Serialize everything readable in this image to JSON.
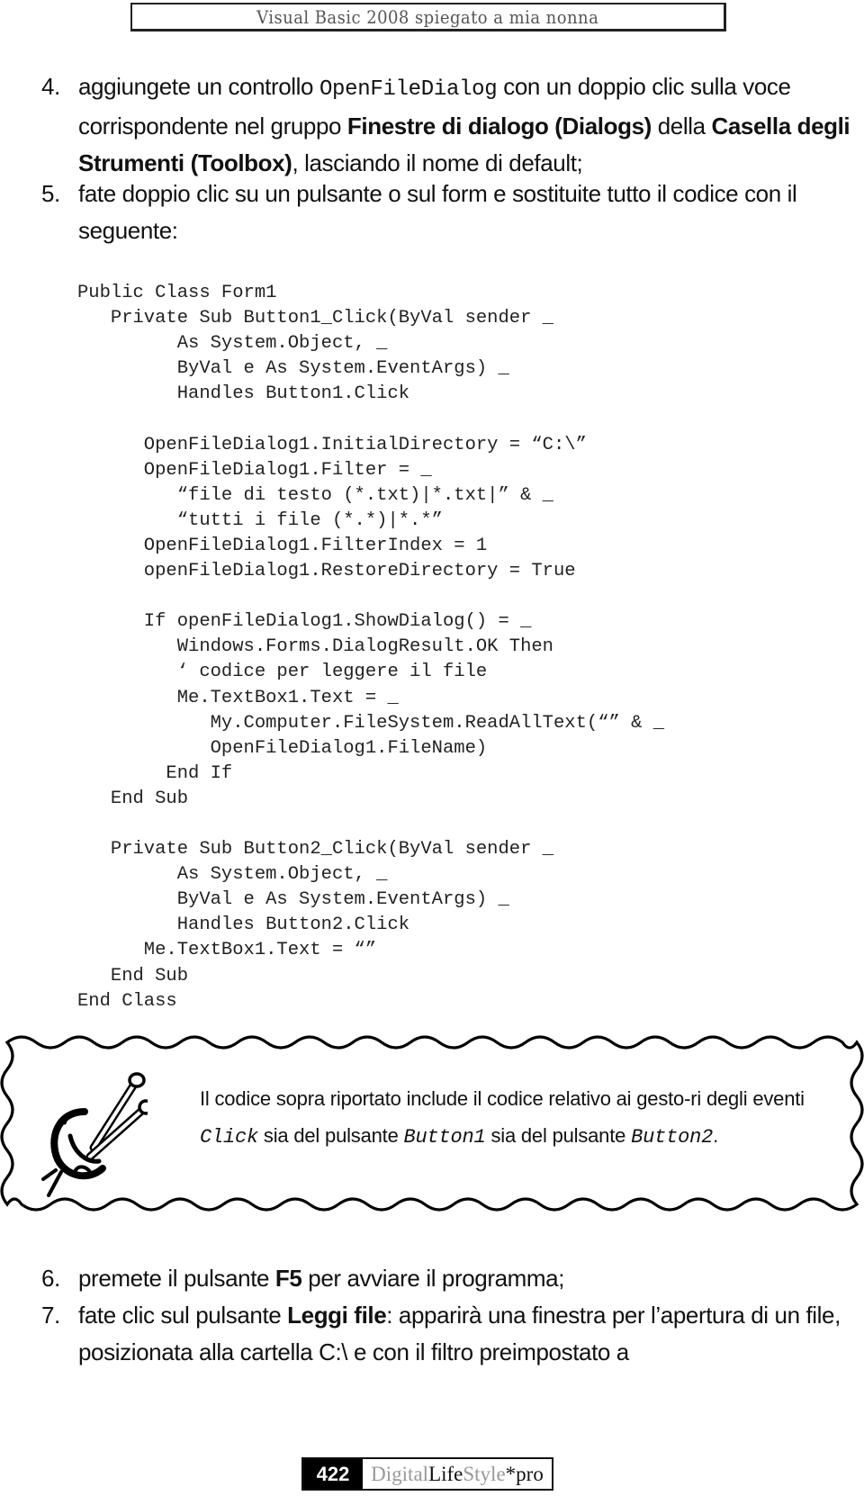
{
  "header": {
    "title": "Visual Basic 2008 spiegato a mia nonna"
  },
  "steps": [
    {
      "number": "4.",
      "parts": {
        "p1": "aggiungete un controllo ",
        "code": "OpenFileDialog",
        "p2": " con un doppio clic sulla voce corrispondente nel gruppo ",
        "bold1": "Finestre di dialogo (Dialogs)",
        "p3": " della ",
        "bold2": "Casella degli Strumenti (Toolbox)",
        "p4": ", lasciando il nome di default;"
      }
    },
    {
      "number": "5.",
      "parts": {
        "p1": "fate doppio clic su un pulsante o sul form e sostituite tutto il codice con il seguente:"
      }
    },
    {
      "number": "6.",
      "parts": {
        "p1": "premete il pulsante ",
        "bold1": "F5",
        "p2": " per avviare il programma;"
      }
    },
    {
      "number": "7.",
      "parts": {
        "p1": "fate clic sul pulsante ",
        "bold1": "Leggi file",
        "p2": ": apparirà una finestra per l’apertura di un file, posizionata alla cartella C:\\ e con il filtro preimpostato a"
      }
    }
  ],
  "code_lines": [
    "Public Class Form1",
    "   Private Sub Button1_Click(ByVal sender _",
    "         As System.Object, _",
    "         ByVal e As System.EventArgs) _",
    "         Handles Button1.Click",
    "",
    "      OpenFileDialog1.InitialDirectory = “C:\\”",
    "      OpenFileDialog1.Filter = _",
    "         “file di testo (*.txt)|*.txt|” & _",
    "         “tutti i file (*.*)|*.*”",
    "      OpenFileDialog1.FilterIndex = 1",
    "      openFileDialog1.RestoreDirectory = True",
    "",
    "      If openFileDialog1.ShowDialog() = _",
    "         Windows.Forms.DialogResult.OK Then",
    "         ‘ codice per leggere il file",
    "         Me.TextBox1.Text = _",
    "            My.Computer.FileSystem.ReadAllText(“” & _",
    "            OpenFileDialog1.FileName)",
    "        End If",
    "   End Sub",
    "",
    "   Private Sub Button2_Click(ByVal sender _",
    "         As System.Object, _",
    "         ByVal e As System.EventArgs) _",
    "         Handles Button2.Click",
    "      Me.TextBox1.Text = “”",
    "   End Sub",
    "End Class"
  ],
  "callout": {
    "icon": "knitting-yarn-icon",
    "t1": "Il codice sopra riportato include il codice relativo ai gesto-ri degli eventi ",
    "c1": "Click",
    "t2": " sia del pulsante ",
    "c2": "Button1",
    "t3": " sia del pulsante ",
    "c3": "Button2",
    "t4": "."
  },
  "footer": {
    "page_number": "422",
    "brand_digital": "Digital",
    "brand_life": "Life",
    "brand_style": "Style",
    "brand_pro": "*pro"
  }
}
